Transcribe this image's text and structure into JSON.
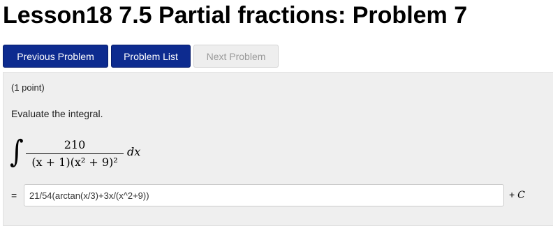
{
  "page": {
    "title": "Lesson18 7.5 Partial fractions: Problem 7"
  },
  "nav": {
    "previous_label": "Previous Problem",
    "list_label": "Problem List",
    "next_label": "Next Problem"
  },
  "problem": {
    "points": "(1 point)",
    "prompt": "Evaluate the integral.",
    "integral": {
      "sign": "∫",
      "numerator": "210",
      "denominator": "(x + 1)(x² + 9)²",
      "differential": "dx"
    },
    "answer": {
      "equals": "=",
      "value": "21/54(arctan(x/3)+3x/(x^2+9))",
      "plus": "+",
      "constant": "C"
    }
  },
  "colors": {
    "primary_button": "#0d2b8f",
    "disabled_button": "#eeeeee",
    "panel_background": "#efefef"
  }
}
